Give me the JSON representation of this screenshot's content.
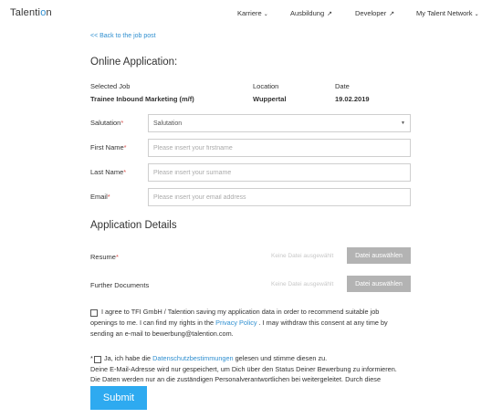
{
  "nav": {
    "logo": {
      "pre": "Talenti",
      "o": "o",
      "post": "n"
    },
    "items": [
      {
        "label": "Karriere",
        "suffix": "⌄"
      },
      {
        "label": "Ausbildung",
        "suffix": "↗"
      },
      {
        "label": "Developer",
        "suffix": "↗"
      },
      {
        "label": "My Talent Network",
        "suffix": "⌄"
      }
    ]
  },
  "back_link": "<< Back to the job post",
  "page_title": "Online Application:",
  "job": {
    "headers": {
      "job": "Selected Job",
      "location": "Location",
      "date": "Date"
    },
    "values": {
      "job": "Trainee Inbound Marketing (m/f)",
      "location": "Wuppertal",
      "date": "19.02.2019"
    }
  },
  "form": {
    "required_mark": "*",
    "salutation": {
      "label": "Salutation",
      "value": "Salutation"
    },
    "first_name": {
      "label": "First Name",
      "placeholder": "Please insert your firstname"
    },
    "last_name": {
      "label": "Last Name",
      "placeholder": "Please insert your surname"
    },
    "email": {
      "label": "Email",
      "placeholder": "Please insert your email address"
    }
  },
  "details": {
    "title": "Application Details",
    "resume": {
      "label": "Resume",
      "no_file": "Keine Datei ausgewählt",
      "button": "Datei auswählen"
    },
    "further": {
      "label": "Further Documents",
      "no_file": "Keine Datei ausgewählt",
      "button": "Datei auswählen"
    }
  },
  "consent": {
    "line1": "I agree to TFI GmbH / Talention saving my application data in order to recommend suitable job",
    "line2_pre": "openings to me. I can find my rights in the",
    "privacy_link": "Privacy Policy",
    "line2_post": ". I may withdraw this consent at any time by",
    "line3": "sending an e-mail to bewerbung@talention.com."
  },
  "privacy": {
    "pre": "Ja, ich habe die",
    "link": "Datenschutzbestimmungen",
    "post": "gelesen und stimme diesen zu.",
    "line2": "Deine E-Mail-Adresse wird nur gespeichert, um Dich über den Status Deiner Bewerbung zu informieren.",
    "line3": "Die Daten werden nur an die zuständigen Personalverantwortlichen bei weitergeleitet. Durch diese"
  },
  "submit_label": "Submit"
}
